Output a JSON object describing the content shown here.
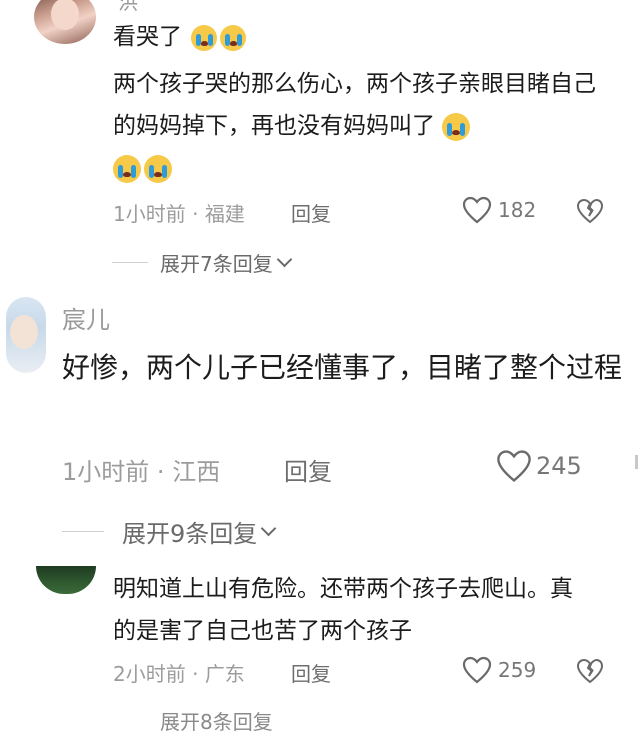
{
  "comments": [
    {
      "username_partial": "洪",
      "line1": "看哭了",
      "body": "两个孩子哭的那么伤心，两个孩子亲眼目睹自己的妈妈掉下，再也没有妈妈叫了",
      "time": "1小时前",
      "dot": "·",
      "location": "福建",
      "reply_label": "回复",
      "likes": "182",
      "expand_label": "展开7条回复"
    },
    {
      "username": "宸儿",
      "body": "好惨，两个儿子已经懂事了，目睹了整个过程",
      "time": "1小时前",
      "dot": "·",
      "location": "江西",
      "reply_label": "回复",
      "likes": "245",
      "expand_label": "展开9条回复"
    },
    {
      "body": "明知道上山有危险。还带两个孩子去爬山。真的是害了自己也苦了两个孩子",
      "time": "2小时前",
      "dot": "·",
      "location": "广东",
      "reply_label": "回复",
      "likes": "259",
      "expand_label_partial": "展开8条回复"
    }
  ],
  "icons": {
    "crying": "crying-face-emoji",
    "like": "heart-icon",
    "dislike": "broken-heart-icon",
    "expand": "chevron-down-icon"
  },
  "colors": {
    "emoji_yellow": "#f7c948",
    "tear_blue": "#2f9bd8",
    "meta_gray": "#9c9c9c"
  }
}
